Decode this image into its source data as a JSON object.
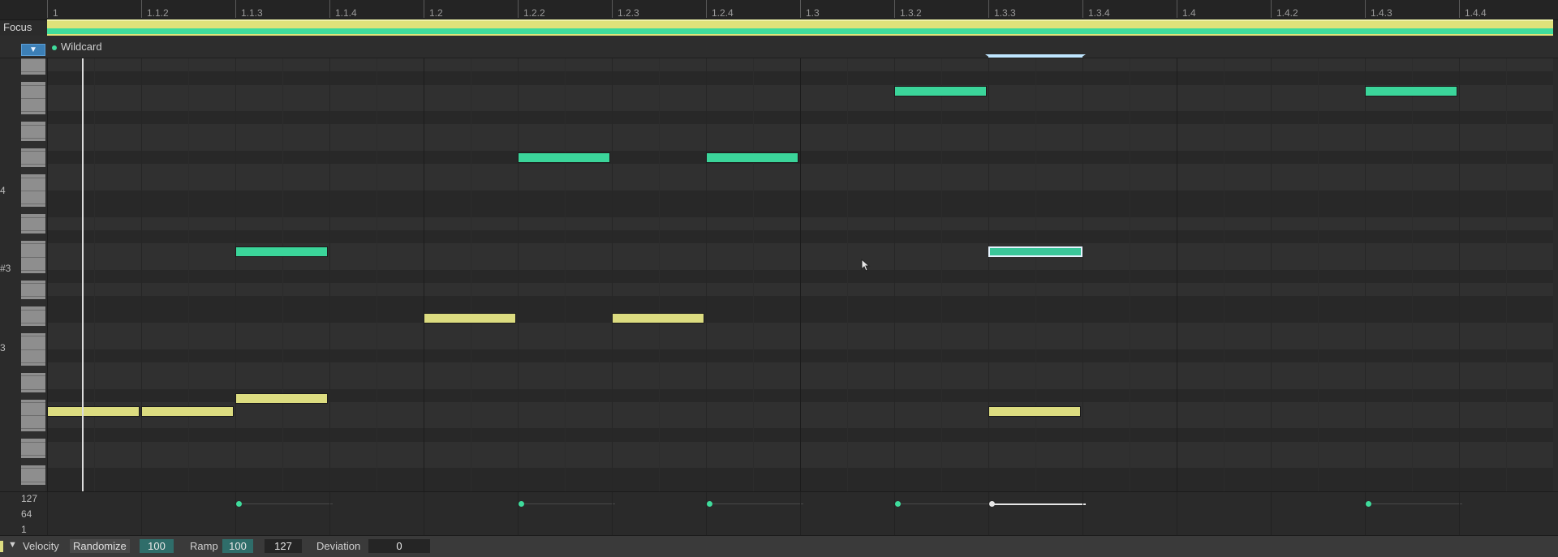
{
  "header": {
    "focus_label": "Focus",
    "ruler_labels": [
      "1",
      "1.1.2",
      "1.1.3",
      "1.1.4",
      "1.2",
      "1.2.2",
      "1.2.3",
      "1.2.4",
      "1.3",
      "1.3.2",
      "1.3.3",
      "1.3.4",
      "1.4",
      "1.4.2",
      "1.4.3",
      "1.4.4"
    ]
  },
  "track": {
    "name": "Wildcard",
    "fold_icon": "fold-icon"
  },
  "piano": {
    "octave_labels": [
      "4",
      "#3",
      "3"
    ]
  },
  "velocity": {
    "scale": [
      "127",
      "64",
      "1"
    ]
  },
  "bottom_bar": {
    "lane_label": "Velocity",
    "randomize_label": "Randomize",
    "randomize_value": "100",
    "ramp_label": "Ramp",
    "ramp_start": "100",
    "ramp_end": "127",
    "deviation_label": "Deviation",
    "deviation_value": "0"
  },
  "colors": {
    "note_green": "#3bd59a",
    "note_yellow": "#dcdc80",
    "loop_bar": "#dfe27a",
    "accent_teal": "#2f6d6a",
    "fold_button": "#3c7fb6"
  }
}
